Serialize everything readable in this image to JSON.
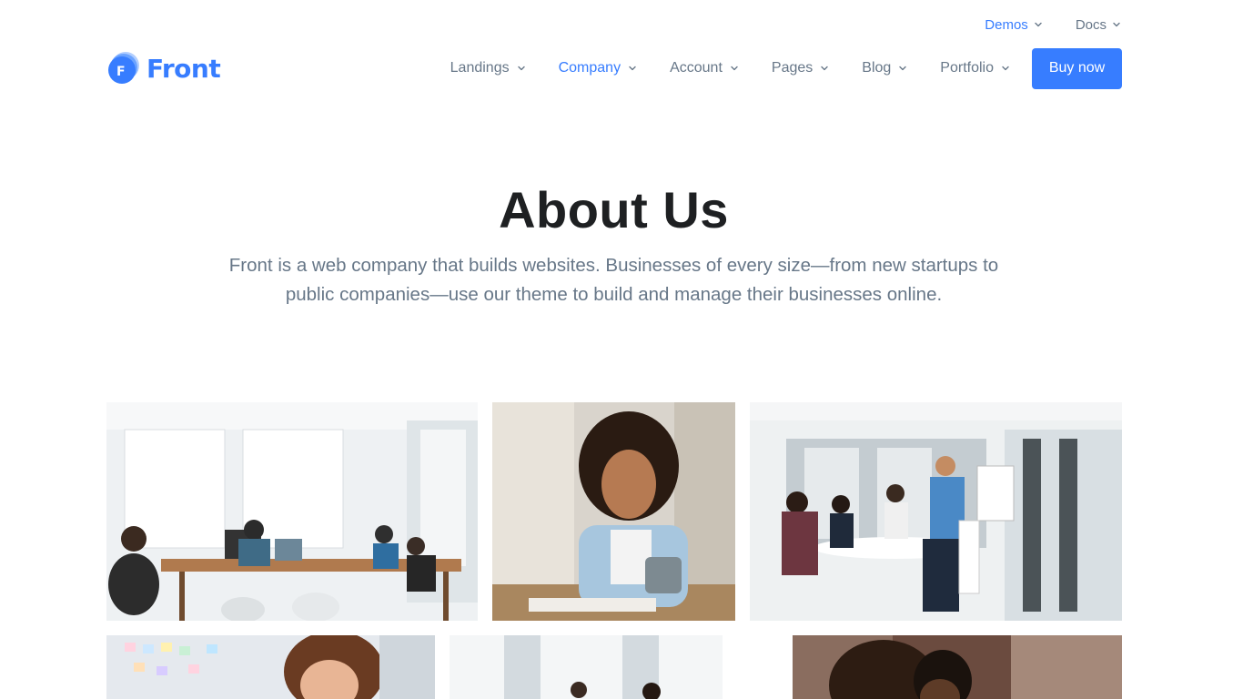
{
  "top_nav": {
    "demos": "Demos",
    "docs": "Docs"
  },
  "logo": {
    "text": "Front",
    "mark_letter": "F"
  },
  "main_nav": {
    "items": [
      {
        "label": "Landings"
      },
      {
        "label": "Company"
      },
      {
        "label": "Account"
      },
      {
        "label": "Pages"
      },
      {
        "label": "Blog"
      },
      {
        "label": "Portfolio"
      }
    ],
    "active": "Company",
    "buy_label": "Buy now"
  },
  "hero": {
    "title": "About Us",
    "subtitle": "Front is a web company that builds websites. Businesses of every size—from new startups to public companies—use our theme to build and manage their businesses online."
  },
  "gallery": {
    "images": [
      {
        "name": "photo-office-team-workspace"
      },
      {
        "name": "photo-smiling-woman-with-mug"
      },
      {
        "name": "photo-meeting-room-team"
      },
      {
        "name": "photo-woman-smiling-sticky-notes"
      },
      {
        "name": "photo-bright-office-people"
      },
      {
        "name": "photo-couple-working-together"
      }
    ]
  },
  "colors": {
    "primary": "#377dff",
    "text": "#1e2022",
    "muted": "#677788"
  }
}
